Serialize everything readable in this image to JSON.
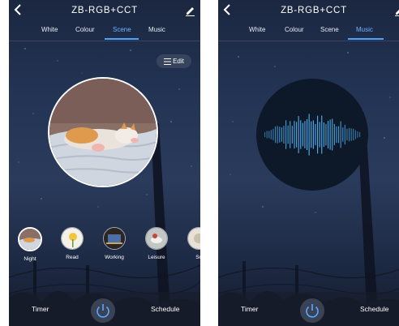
{
  "screens": [
    {
      "title": "ZB-RGB+CCT",
      "tabs": [
        "White",
        "Colour",
        "Scene",
        "Music"
      ],
      "active_tab": "Scene",
      "edit_label": "Edit",
      "scenes": [
        {
          "label": "Night",
          "selected": true
        },
        {
          "label": "Read",
          "selected": false
        },
        {
          "label": "Working",
          "selected": false
        },
        {
          "label": "Leisure",
          "selected": false
        },
        {
          "label": "Sc",
          "selected": false
        }
      ],
      "bottom": {
        "timer": "Timer",
        "schedule": "Schedule"
      }
    },
    {
      "title": "ZB-RGB+CCT",
      "tabs": [
        "White",
        "Colour",
        "Scene",
        "Music"
      ],
      "active_tab": "Music",
      "bottom": {
        "timer": "Timer",
        "schedule": "Schedule"
      }
    }
  ],
  "colors": {
    "accent": "#4da3ff",
    "active_tab_text": "#6fb2ff",
    "sky_top": "#1b2740",
    "sky_mid": "#2a3b5c",
    "wave_green": "#2fd6a0",
    "wave_blue": "#4a8cff"
  },
  "icons": {
    "back": "chevron-left-icon",
    "edit": "pencil-icon",
    "power": "power-icon",
    "list": "list-icon"
  }
}
